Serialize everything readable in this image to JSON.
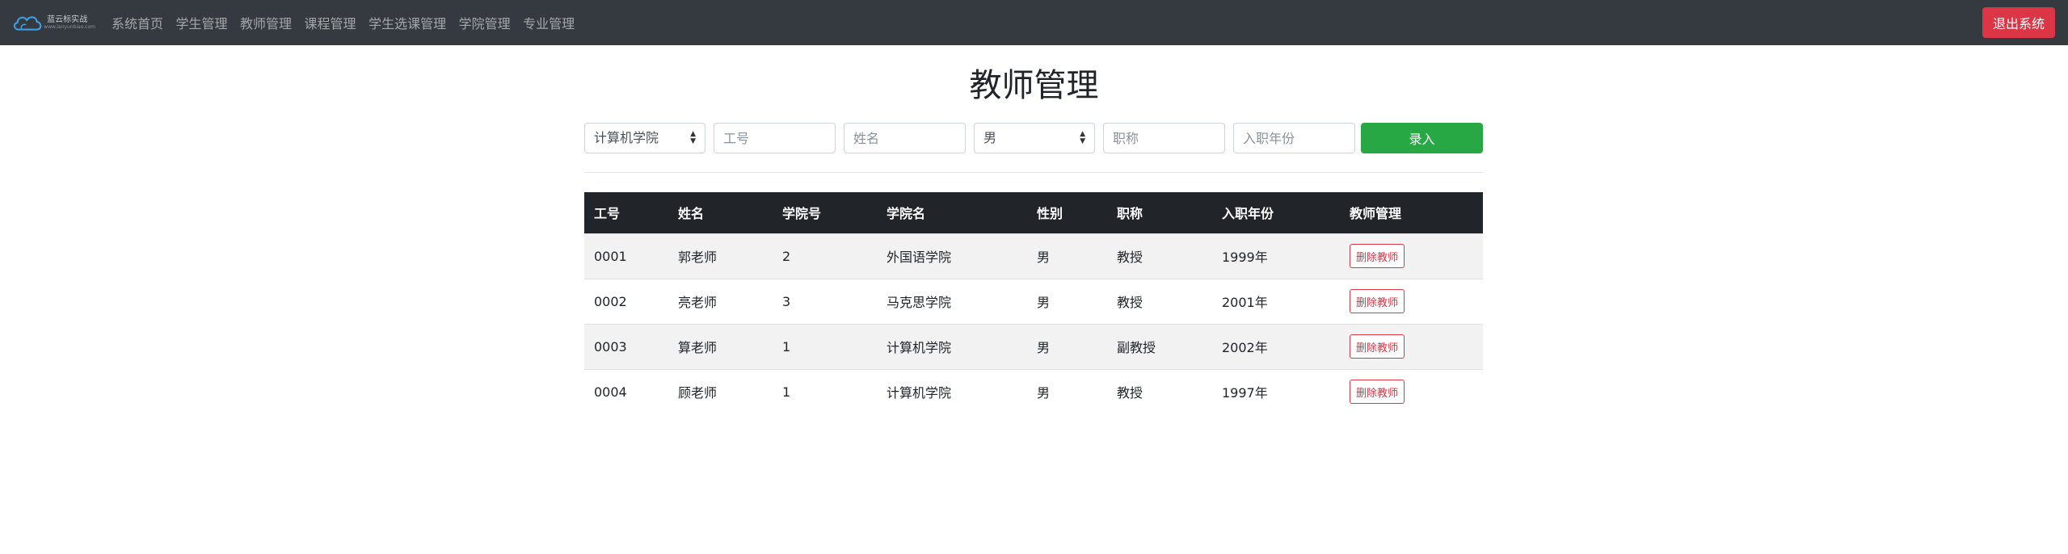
{
  "navbar": {
    "brand_name": "蓝云标实战",
    "brand_sub": "www.lanyunbiao.com",
    "links": [
      "系统首页",
      "学生管理",
      "教师管理",
      "课程管理",
      "学生选课管理",
      "学院管理",
      "专业管理"
    ],
    "logout_label": "退出系统"
  },
  "page": {
    "title": "教师管理"
  },
  "form": {
    "college_selected": "计算机学院",
    "teacher_id_placeholder": "工号",
    "name_placeholder": "姓名",
    "gender_selected": "男",
    "title_placeholder": "职称",
    "year_placeholder": "入职年份",
    "submit_label": "录入"
  },
  "table": {
    "headers": [
      "工号",
      "姓名",
      "学院号",
      "学院名",
      "性别",
      "职称",
      "入职年份",
      "教师管理"
    ],
    "rows": [
      {
        "id": "0001",
        "name": "郭老师",
        "college_no": "2",
        "college_name": "外国语学院",
        "gender": "男",
        "title": "教授",
        "year": "1999年",
        "action": "删除教师"
      },
      {
        "id": "0002",
        "name": "亮老师",
        "college_no": "3",
        "college_name": "马克思学院",
        "gender": "男",
        "title": "教授",
        "year": "2001年",
        "action": "删除教师"
      },
      {
        "id": "0003",
        "name": "算老师",
        "college_no": "1",
        "college_name": "计算机学院",
        "gender": "男",
        "title": "副教授",
        "year": "2002年",
        "action": "删除教师"
      },
      {
        "id": "0004",
        "name": "顾老师",
        "college_no": "1",
        "college_name": "计算机学院",
        "gender": "男",
        "title": "教授",
        "year": "1997年",
        "action": "删除教师"
      }
    ]
  },
  "colors": {
    "navbar_bg": "#343a40",
    "danger": "#dc3545",
    "success": "#28a745",
    "table_header_bg": "#212529",
    "stripe_bg": "#f2f2f2"
  },
  "icons": {
    "brand_logo": "cloud-icon",
    "select_caret": "sort-caret-icon"
  }
}
